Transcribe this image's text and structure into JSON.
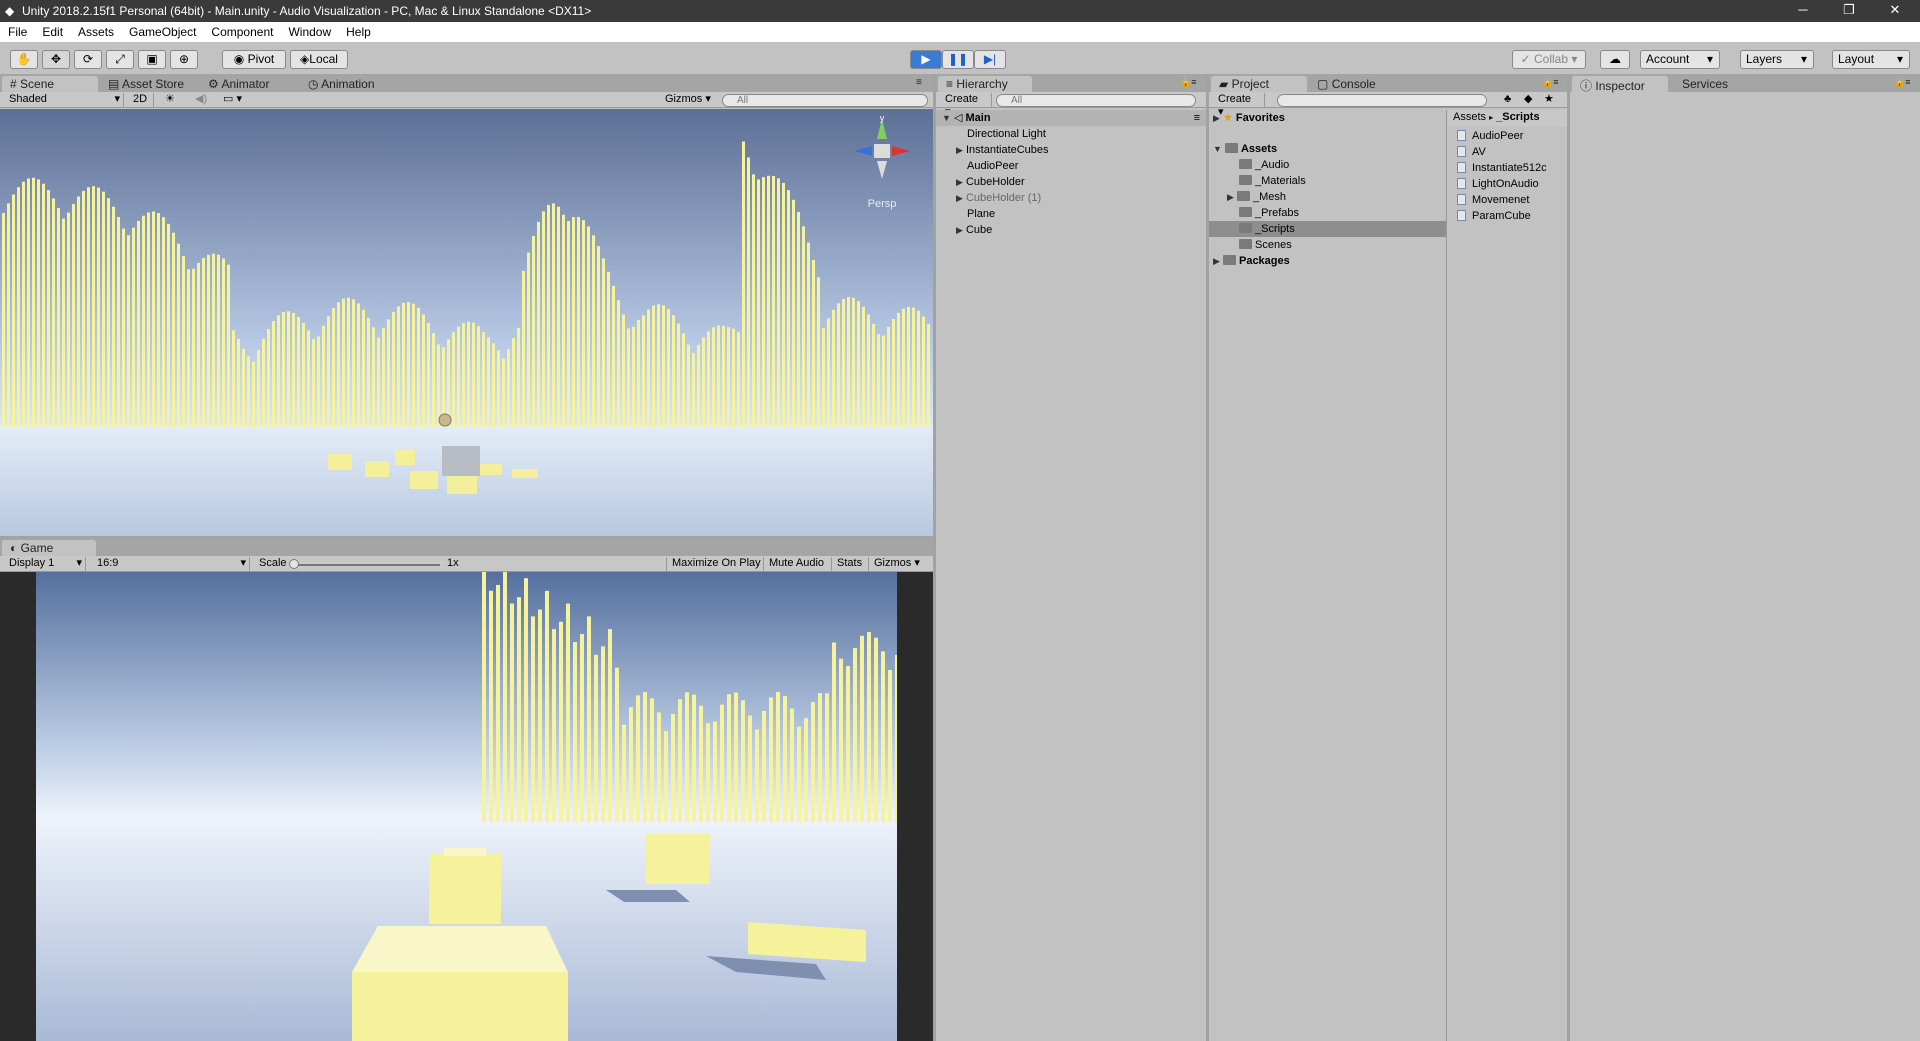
{
  "window": {
    "title": "Unity 2018.2.15f1 Personal (64bit) - Main.unity - Audio Visualization - PC, Mac & Linux Standalone <DX11>"
  },
  "menu": [
    "File",
    "Edit",
    "Assets",
    "GameObject",
    "Component",
    "Window",
    "Help"
  ],
  "toolbar": {
    "pivot": "Pivot",
    "local": "Local",
    "collab": "Collab",
    "account": "Account",
    "layers": "Layers",
    "layout": "Layout"
  },
  "scene": {
    "tabs": [
      "Scene",
      "Asset Store",
      "Animator",
      "Animation"
    ],
    "shading": "Shaded",
    "mode2d": "2D",
    "gizmos": "Gizmos",
    "search": "All",
    "persp": "Persp"
  },
  "game": {
    "tab": "Game",
    "display": "Display 1",
    "aspect": "16:9",
    "scale_label": "Scale",
    "scale_value": "1x",
    "maximize": "Maximize On Play",
    "mute": "Mute Audio",
    "stats": "Stats",
    "gizmos": "Gizmos"
  },
  "hierarchy": {
    "tab": "Hierarchy",
    "create": "Create",
    "search": "All",
    "scene": "Main",
    "items": [
      "Directional Light",
      "InstantiateCubes",
      "AudioPeer",
      "CubeHolder",
      "CubeHolder (1)",
      "Plane",
      "Cube"
    ]
  },
  "project": {
    "tabs": [
      "Project",
      "Console"
    ],
    "create": "Create",
    "favorites": "Favorites",
    "assets": "Assets",
    "folders": [
      "_Audio",
      "_Materials",
      "_Mesh",
      "_Prefabs",
      "_Scripts",
      "Scenes"
    ],
    "packages": "Packages",
    "breadcrumb": [
      "Assets",
      "_Scripts"
    ],
    "scripts": [
      "AudioPeer",
      "AV",
      "Instantiate512c",
      "LightOnAudio",
      "Movemenet",
      "ParamCube"
    ]
  },
  "inspector": {
    "tabs": [
      "Inspector",
      "Services"
    ]
  },
  "colors": {
    "bar": "#f7f39a",
    "sky_top": "#5b7299",
    "ground": "#cdd8ec",
    "selection": "#8e8e8e",
    "play_accent": "#3a7bd5"
  }
}
